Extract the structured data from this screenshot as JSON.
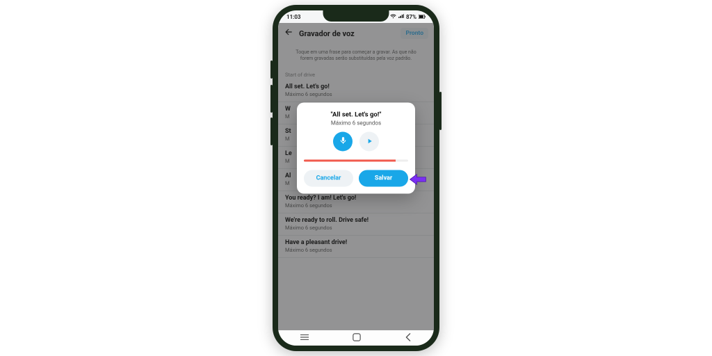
{
  "statusbar": {
    "time": "11:03",
    "battery": "87%"
  },
  "appbar": {
    "title": "Gravador de voz",
    "done": "Pronto"
  },
  "help": "Toque em uma frase para começar a gravar. As que não forem gravadas serão substituídas pela voz padrão.",
  "section": "Start of drive",
  "phrases": [
    {
      "title": "All set. Let's go!",
      "sub": "Máximo 6 segundos"
    },
    {
      "title": "W",
      "sub": "M"
    },
    {
      "title": "St",
      "sub": "M"
    },
    {
      "title": "Le",
      "sub": "M"
    },
    {
      "title": "Al",
      "sub": "M"
    },
    {
      "title": "You ready? I am! Let's go!",
      "sub": "Máximo 6 segundos"
    },
    {
      "title": "We're ready to roll. Drive safe!",
      "sub": "Máximo 6 segundos"
    },
    {
      "title": "Have a pleasant drive!",
      "sub": "Máximo 6 segundos"
    }
  ],
  "modal": {
    "title": "\"All set. Let's go!\"",
    "sub": "Máximo 6 segundos",
    "cancel": "Cancelar",
    "save": "Salvar"
  },
  "colors": {
    "accent": "#19a7e8",
    "progress": "#f15b4e",
    "pointer": "#7b2ff2"
  }
}
